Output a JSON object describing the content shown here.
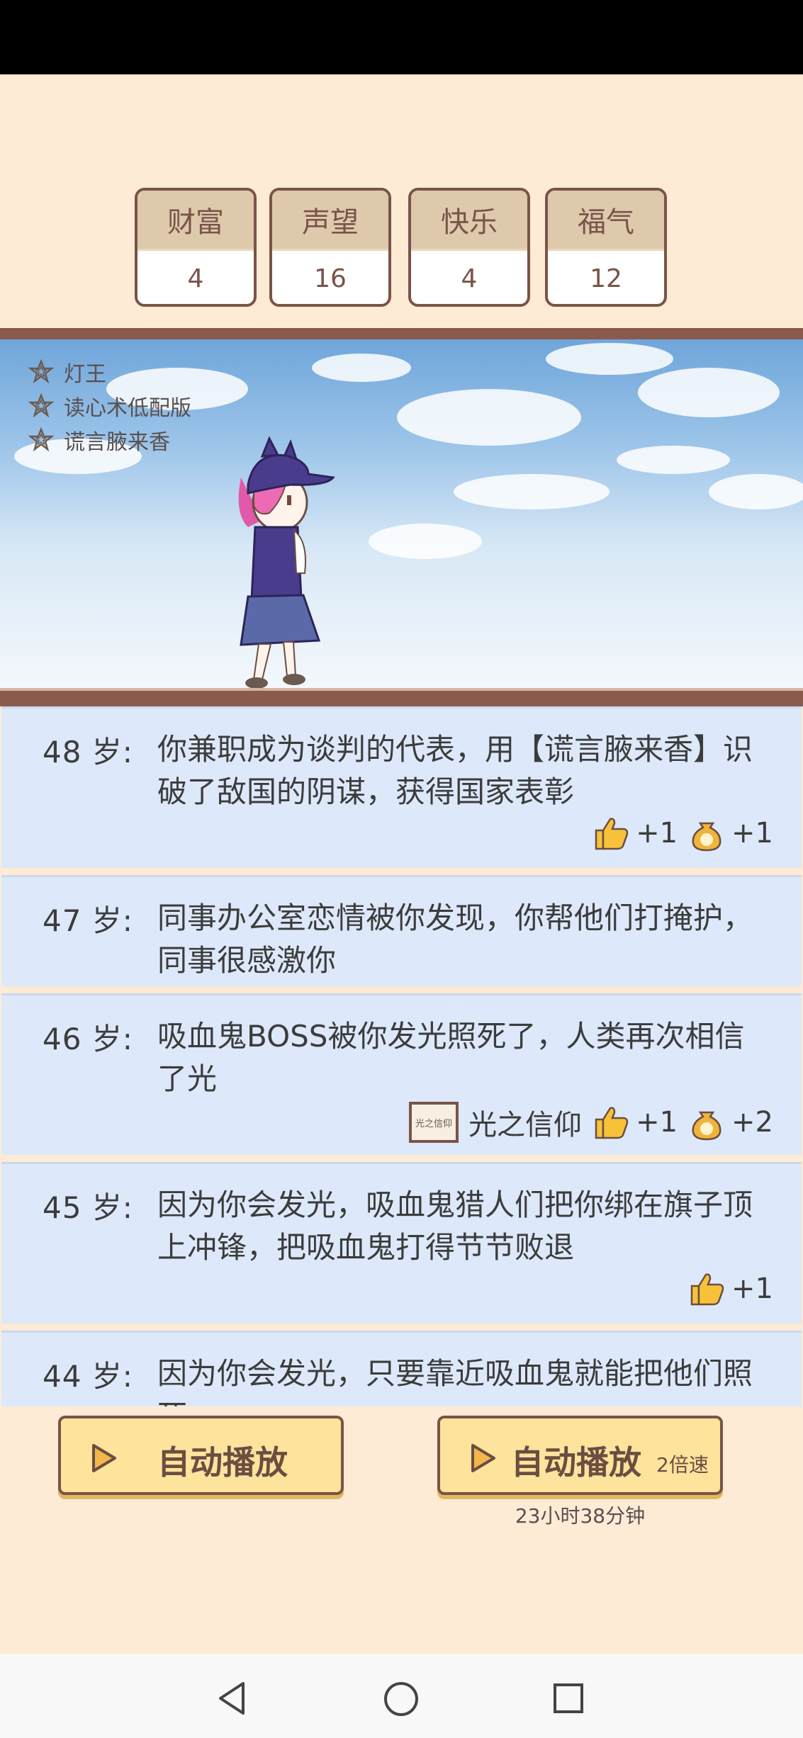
{
  "stats": [
    {
      "label": "财富",
      "value": "4"
    },
    {
      "label": "声望",
      "value": "16"
    },
    {
      "label": "快乐",
      "value": "4"
    },
    {
      "label": "福气",
      "value": "12"
    }
  ],
  "skills": [
    "灯王",
    "读心术低配版",
    "谎言腋来香"
  ],
  "log": [
    {
      "age": "48 岁:",
      "text": "你兼职成为谈判的代表，用【谎言腋来香】识破了敌国的阴谋，获得国家表彰",
      "like": "+1",
      "luck": "+1"
    },
    {
      "age": "47 岁:",
      "text": "同事办公室恋情被你发现，你帮他们打掩护，同事很感激你"
    },
    {
      "age": "46 岁:",
      "text": "吸血鬼BOSS被你发光照死了，人类再次相信了光",
      "badge_label": "光之信仰",
      "badge_icon_text": "光之信仰",
      "like": "+1",
      "luck": "+2"
    },
    {
      "age": "45 岁:",
      "text": "因为你会发光，吸血鬼猎人们把你绑在旗子顶上冲锋，把吸血鬼打得节节败退",
      "like": "+1"
    },
    {
      "age": "44 岁:",
      "text": "因为你会发光，只要靠近吸血鬼就能把他们照死"
    }
  ],
  "buttons": {
    "auto_play": "自动播放",
    "auto_play_2x": "自动播放",
    "speed_label": "2倍速",
    "timer": "23小时38分钟"
  },
  "icons": {
    "star": "star-outline-icon",
    "like": "thumbs-up-icon",
    "luck": "fortune-bag-icon",
    "play": "play-triangle-icon",
    "back": "back-triangle-icon",
    "home": "home-circle-icon",
    "recent": "recent-square-icon"
  },
  "colors": {
    "background": "#fdebd5",
    "panel": "#dde9fa",
    "button": "#fde39c",
    "border": "#7a5448"
  }
}
